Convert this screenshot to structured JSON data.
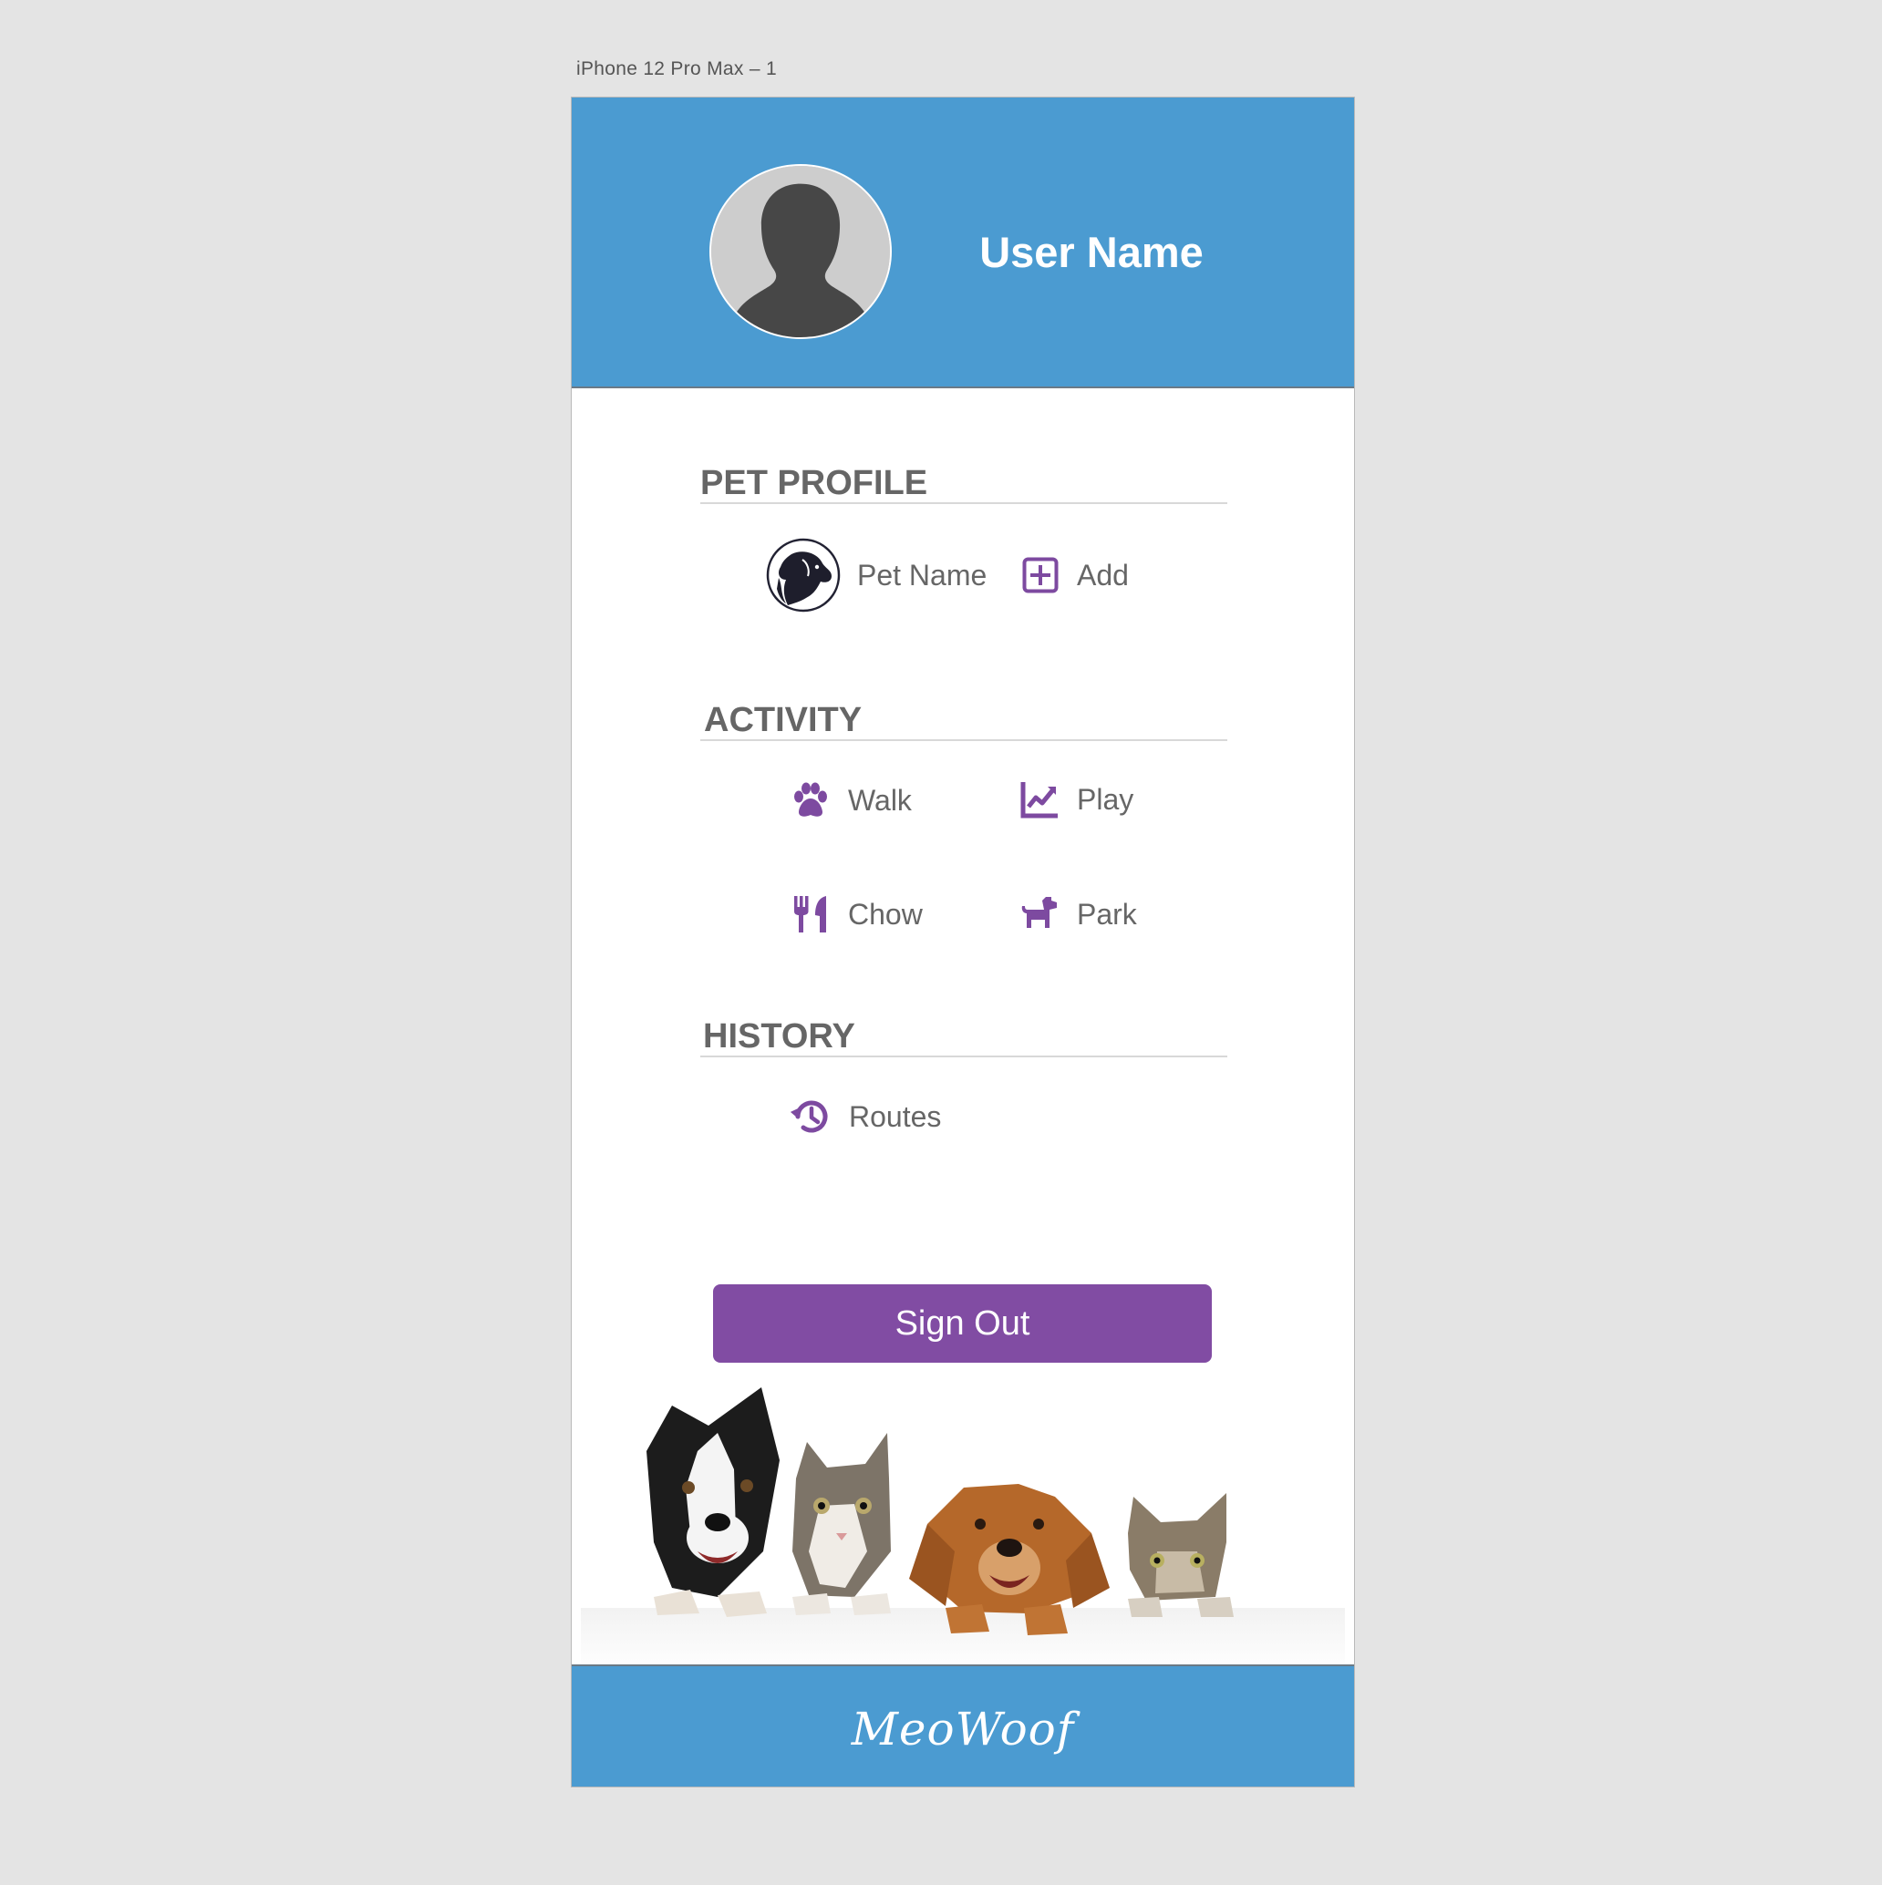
{
  "artboard_label": "iPhone 12 Pro Max – 1",
  "header": {
    "user_name": "User Name",
    "avatar_icon": "person-silhouette-icon"
  },
  "pet_profile": {
    "title": "PET PROFILE",
    "pet_name": "Pet Name",
    "pet_icon": "pet-avatar-icon",
    "add_label": "Add",
    "add_icon": "plus-square-icon"
  },
  "activity": {
    "title": "ACTIVITY",
    "items": [
      {
        "label": "Walk",
        "icon": "paw-icon"
      },
      {
        "label": "Play",
        "icon": "chart-line-icon"
      },
      {
        "label": "Chow",
        "icon": "utensils-icon"
      },
      {
        "label": "Park",
        "icon": "dog-icon"
      }
    ]
  },
  "history": {
    "title": "HISTORY",
    "items": [
      {
        "label": "Routes",
        "icon": "history-icon"
      }
    ]
  },
  "sign_out_label": "Sign Out",
  "footer": {
    "brand": "MeoWoof"
  },
  "colors": {
    "header_blue": "#4b9bd1",
    "accent_purple": "#814ca3",
    "icon_purple": "#7d4aa0",
    "section_text": "#666666"
  }
}
